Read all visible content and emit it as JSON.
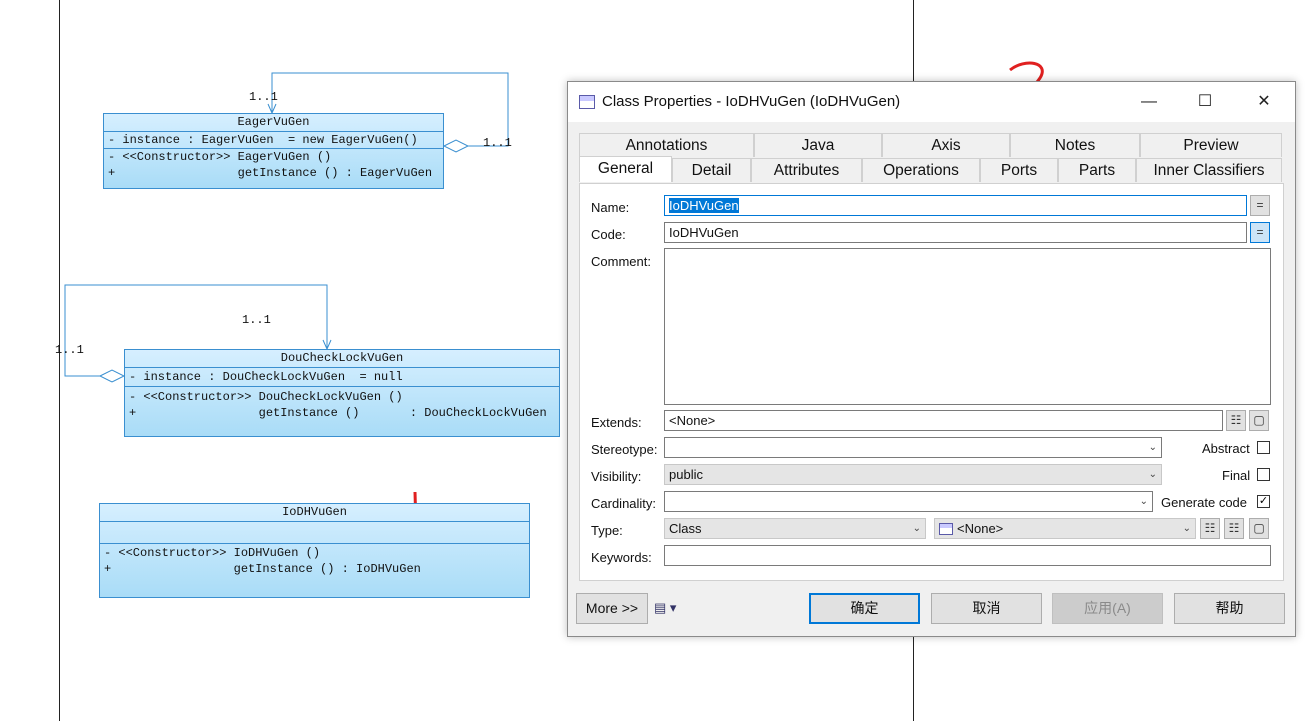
{
  "diagram": {
    "eager": {
      "title": "EagerVuGen",
      "attr": "- instance : EagerVuGen  = new EagerVuGen()",
      "op1": "- <<Constructor>> EagerVuGen ()",
      "op2": "+                 getInstance () : EagerVuGen",
      "mult_top": "1..1",
      "mult_right": "1..1"
    },
    "dcl": {
      "title": "DouCheckLockVuGen",
      "attr": "- instance : DouCheckLockVuGen  = null",
      "op1": "- <<Constructor>> DouCheckLockVuGen ()",
      "op2": "+                 getInstance ()       : DouCheckLockVuGen",
      "mult_top": "1..1",
      "mult_left": "1..1"
    },
    "iodh": {
      "title": "IoDHVuGen",
      "op1": "- <<Constructor>> IoDHVuGen ()",
      "op2": "+                 getInstance () : IoDHVuGen"
    },
    "annotation1": "1",
    "annotation2": "2"
  },
  "dialog": {
    "title": "Class Properties - IoDHVuGen (IoDHVuGen)",
    "tabs_back": [
      "Annotations",
      "Java",
      "Axis",
      "Notes",
      "Preview"
    ],
    "tabs_front": [
      "General",
      "Detail",
      "Attributes",
      "Operations",
      "Ports",
      "Parts",
      "Inner Classifiers"
    ],
    "active_tab": "General",
    "labels": {
      "name": "Name:",
      "code": "Code:",
      "comment": "Comment:",
      "extends": "Extends:",
      "stereotype": "Stereotype:",
      "visibility": "Visibility:",
      "cardinality": "Cardinality:",
      "type": "Type:",
      "keywords": "Keywords:",
      "abstract": "Abstract",
      "final": "Final",
      "generate_code": "Generate code"
    },
    "values": {
      "name": "IoDHVuGen",
      "code": "IoDHVuGen",
      "comment": "",
      "extends": "<None>",
      "stereotype": "",
      "visibility": "public",
      "cardinality": "",
      "type": "Class",
      "type_classifier": "<None>",
      "keywords": "",
      "abstract": false,
      "final": false,
      "generate_code": true
    },
    "buttons": {
      "more": "More >>",
      "ok": "确定",
      "cancel": "取消",
      "apply": "应用(A)",
      "help": "帮助"
    }
  }
}
